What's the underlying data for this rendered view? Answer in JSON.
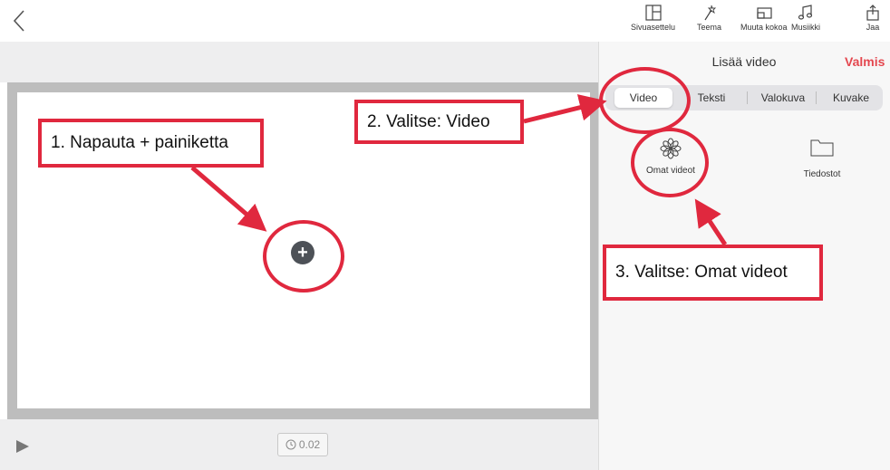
{
  "toolbar": {
    "items": [
      {
        "label": "Sivuasettelu",
        "icon": "layout-icon"
      },
      {
        "label": "Teema",
        "icon": "magic-wand-icon"
      },
      {
        "label": "Muuta kokoa",
        "icon": "resize-icon"
      },
      {
        "label": "Musiikki",
        "icon": "music-note-icon"
      },
      {
        "label": "Jaa",
        "icon": "share-icon"
      }
    ]
  },
  "editor": {
    "duration": "0.02"
  },
  "panel": {
    "title": "Lisää video",
    "done": "Valmis",
    "tabs": [
      "Video",
      "Teksti",
      "Valokuva",
      "Kuvake"
    ],
    "options": [
      {
        "label": "Omat videot",
        "icon": "flower-icon"
      },
      {
        "label": "Tiedostot",
        "icon": "folder-icon"
      }
    ]
  },
  "annotations": {
    "step1": "1. Napauta + painiketta",
    "step2": "2. Valitse: Video",
    "step3": "3. Valitse: Omat videot"
  },
  "colors": {
    "accent": "#e4474f",
    "annotation": "#e0283e"
  }
}
